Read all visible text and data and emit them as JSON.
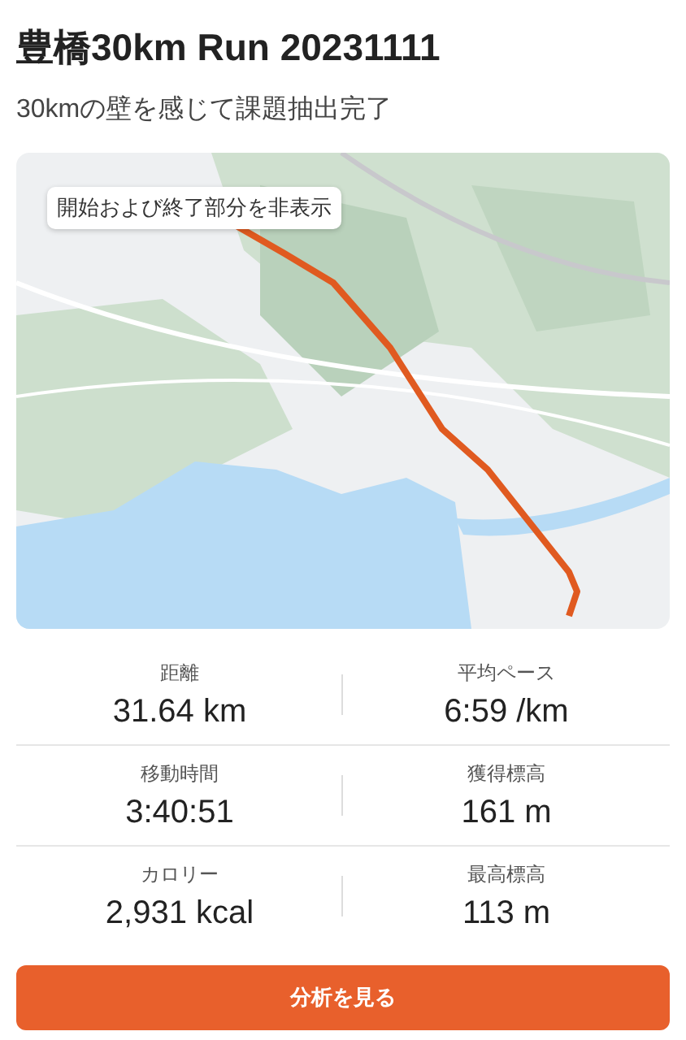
{
  "activity": {
    "title": "豊橋30km Run 20231111",
    "description": "30kmの壁を感じて課題抽出完了"
  },
  "map": {
    "kind": "picture",
    "privacy_chip": "開始および終了部分を非表示"
  },
  "stats": [
    {
      "label": "距離",
      "value": "31.64 km"
    },
    {
      "label": "平均ペース",
      "value": "6:59 /km"
    },
    {
      "label": "移動時間",
      "value": "3:40:51"
    },
    {
      "label": "獲得標高",
      "value": "161 m"
    },
    {
      "label": "カロリー",
      "value": "2,931 kcal"
    },
    {
      "label": "最高標高",
      "value": "113 m"
    }
  ],
  "button": {
    "label": "分析を見る"
  }
}
